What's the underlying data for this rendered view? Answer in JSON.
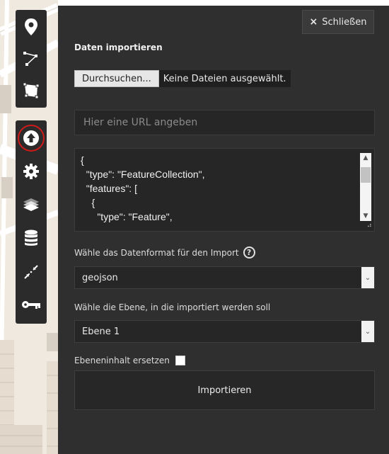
{
  "panel": {
    "close_label": "Schließen",
    "close_icon": "×",
    "title": "Daten importieren",
    "file": {
      "button_label": "Durchsuchen...",
      "status": "Keine Dateien ausgewählt."
    },
    "url_placeholder": "Hier eine URL angeben",
    "textarea_text": "{\n  \"type\": \"FeatureCollection\",\n  \"features\": [\n    {\n      \"type\": \"Feature\",",
    "format_label": "Wähle das Datenformat für den Import",
    "format_value": "geojson",
    "layer_label": "Wähle die Ebene, in die importiert werden soll",
    "layer_value": "Ebene 1",
    "replace_label": "Ebeneninhalt ersetzen",
    "replace_checked": false,
    "import_label": "Importieren"
  },
  "toolbar": {
    "top": [
      "marker-icon",
      "polyline-icon",
      "polygon-icon"
    ],
    "bottom": [
      "upload-icon",
      "gear-icon",
      "layers-icon",
      "database-icon",
      "scale-arrows-icon",
      "key-icon"
    ],
    "active": "upload-icon"
  },
  "colors": {
    "panel_bg": "#2f2f2f",
    "highlight_ring": "#d01a1a"
  }
}
